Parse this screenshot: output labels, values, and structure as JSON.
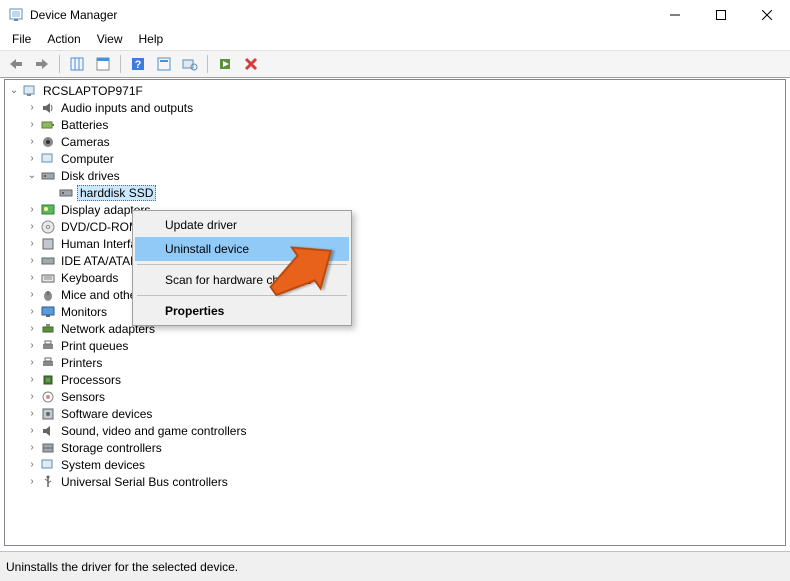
{
  "titlebar": {
    "title": "Device Manager"
  },
  "menubar": {
    "file": "File",
    "action": "Action",
    "view": "View",
    "help": "Help"
  },
  "tree": {
    "root": "RCSLAPTOP971F",
    "items": [
      {
        "label": "Audio inputs and outputs"
      },
      {
        "label": "Batteries"
      },
      {
        "label": "Cameras"
      },
      {
        "label": "Computer"
      },
      {
        "label": "Disk drives",
        "expanded": true,
        "children": [
          {
            "label": "harddisk SSD"
          }
        ]
      },
      {
        "label": "Display adapters"
      },
      {
        "label": "DVD/CD-ROM"
      },
      {
        "label": "Human Interface"
      },
      {
        "label": "IDE ATA/ATAPI"
      },
      {
        "label": "Keyboards"
      },
      {
        "label": "Mice and other pointing devices"
      },
      {
        "label": "Monitors"
      },
      {
        "label": "Network adapters"
      },
      {
        "label": "Print queues"
      },
      {
        "label": "Printers"
      },
      {
        "label": "Processors"
      },
      {
        "label": "Sensors"
      },
      {
        "label": "Software devices"
      },
      {
        "label": "Sound, video and game controllers"
      },
      {
        "label": "Storage controllers"
      },
      {
        "label": "System devices"
      },
      {
        "label": "Universal Serial Bus controllers"
      }
    ]
  },
  "context_menu": {
    "update": "Update driver",
    "uninstall": "Uninstall device",
    "scan": "Scan for hardware changes",
    "properties": "Properties"
  },
  "statusbar": {
    "text": "Uninstalls the driver for the selected device."
  }
}
